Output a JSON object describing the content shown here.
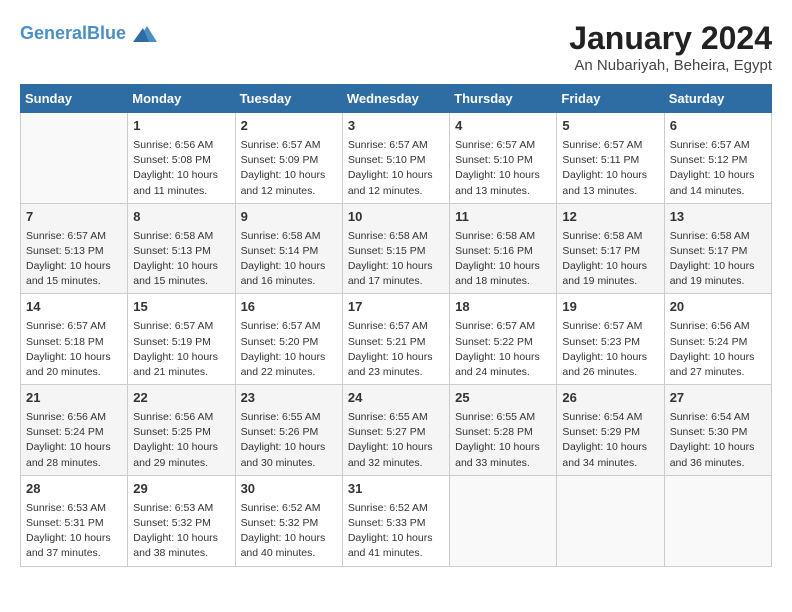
{
  "logo": {
    "line1": "General",
    "line2": "Blue"
  },
  "title": "January 2024",
  "subtitle": "An Nubariyah, Beheira, Egypt",
  "headers": [
    "Sunday",
    "Monday",
    "Tuesday",
    "Wednesday",
    "Thursday",
    "Friday",
    "Saturday"
  ],
  "weeks": [
    [
      {
        "day": "",
        "info": ""
      },
      {
        "day": "1",
        "info": "Sunrise: 6:56 AM\nSunset: 5:08 PM\nDaylight: 10 hours\nand 11 minutes."
      },
      {
        "day": "2",
        "info": "Sunrise: 6:57 AM\nSunset: 5:09 PM\nDaylight: 10 hours\nand 12 minutes."
      },
      {
        "day": "3",
        "info": "Sunrise: 6:57 AM\nSunset: 5:10 PM\nDaylight: 10 hours\nand 12 minutes."
      },
      {
        "day": "4",
        "info": "Sunrise: 6:57 AM\nSunset: 5:10 PM\nDaylight: 10 hours\nand 13 minutes."
      },
      {
        "day": "5",
        "info": "Sunrise: 6:57 AM\nSunset: 5:11 PM\nDaylight: 10 hours\nand 13 minutes."
      },
      {
        "day": "6",
        "info": "Sunrise: 6:57 AM\nSunset: 5:12 PM\nDaylight: 10 hours\nand 14 minutes."
      }
    ],
    [
      {
        "day": "7",
        "info": "Sunrise: 6:57 AM\nSunset: 5:13 PM\nDaylight: 10 hours\nand 15 minutes."
      },
      {
        "day": "8",
        "info": "Sunrise: 6:58 AM\nSunset: 5:13 PM\nDaylight: 10 hours\nand 15 minutes."
      },
      {
        "day": "9",
        "info": "Sunrise: 6:58 AM\nSunset: 5:14 PM\nDaylight: 10 hours\nand 16 minutes."
      },
      {
        "day": "10",
        "info": "Sunrise: 6:58 AM\nSunset: 5:15 PM\nDaylight: 10 hours\nand 17 minutes."
      },
      {
        "day": "11",
        "info": "Sunrise: 6:58 AM\nSunset: 5:16 PM\nDaylight: 10 hours\nand 18 minutes."
      },
      {
        "day": "12",
        "info": "Sunrise: 6:58 AM\nSunset: 5:17 PM\nDaylight: 10 hours\nand 19 minutes."
      },
      {
        "day": "13",
        "info": "Sunrise: 6:58 AM\nSunset: 5:17 PM\nDaylight: 10 hours\nand 19 minutes."
      }
    ],
    [
      {
        "day": "14",
        "info": "Sunrise: 6:57 AM\nSunset: 5:18 PM\nDaylight: 10 hours\nand 20 minutes."
      },
      {
        "day": "15",
        "info": "Sunrise: 6:57 AM\nSunset: 5:19 PM\nDaylight: 10 hours\nand 21 minutes."
      },
      {
        "day": "16",
        "info": "Sunrise: 6:57 AM\nSunset: 5:20 PM\nDaylight: 10 hours\nand 22 minutes."
      },
      {
        "day": "17",
        "info": "Sunrise: 6:57 AM\nSunset: 5:21 PM\nDaylight: 10 hours\nand 23 minutes."
      },
      {
        "day": "18",
        "info": "Sunrise: 6:57 AM\nSunset: 5:22 PM\nDaylight: 10 hours\nand 24 minutes."
      },
      {
        "day": "19",
        "info": "Sunrise: 6:57 AM\nSunset: 5:23 PM\nDaylight: 10 hours\nand 26 minutes."
      },
      {
        "day": "20",
        "info": "Sunrise: 6:56 AM\nSunset: 5:24 PM\nDaylight: 10 hours\nand 27 minutes."
      }
    ],
    [
      {
        "day": "21",
        "info": "Sunrise: 6:56 AM\nSunset: 5:24 PM\nDaylight: 10 hours\nand 28 minutes."
      },
      {
        "day": "22",
        "info": "Sunrise: 6:56 AM\nSunset: 5:25 PM\nDaylight: 10 hours\nand 29 minutes."
      },
      {
        "day": "23",
        "info": "Sunrise: 6:55 AM\nSunset: 5:26 PM\nDaylight: 10 hours\nand 30 minutes."
      },
      {
        "day": "24",
        "info": "Sunrise: 6:55 AM\nSunset: 5:27 PM\nDaylight: 10 hours\nand 32 minutes."
      },
      {
        "day": "25",
        "info": "Sunrise: 6:55 AM\nSunset: 5:28 PM\nDaylight: 10 hours\nand 33 minutes."
      },
      {
        "day": "26",
        "info": "Sunrise: 6:54 AM\nSunset: 5:29 PM\nDaylight: 10 hours\nand 34 minutes."
      },
      {
        "day": "27",
        "info": "Sunrise: 6:54 AM\nSunset: 5:30 PM\nDaylight: 10 hours\nand 36 minutes."
      }
    ],
    [
      {
        "day": "28",
        "info": "Sunrise: 6:53 AM\nSunset: 5:31 PM\nDaylight: 10 hours\nand 37 minutes."
      },
      {
        "day": "29",
        "info": "Sunrise: 6:53 AM\nSunset: 5:32 PM\nDaylight: 10 hours\nand 38 minutes."
      },
      {
        "day": "30",
        "info": "Sunrise: 6:52 AM\nSunset: 5:32 PM\nDaylight: 10 hours\nand 40 minutes."
      },
      {
        "day": "31",
        "info": "Sunrise: 6:52 AM\nSunset: 5:33 PM\nDaylight: 10 hours\nand 41 minutes."
      },
      {
        "day": "",
        "info": ""
      },
      {
        "day": "",
        "info": ""
      },
      {
        "day": "",
        "info": ""
      }
    ]
  ]
}
